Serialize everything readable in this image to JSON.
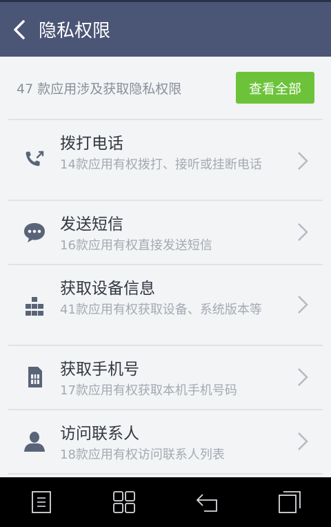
{
  "header": {
    "title": "隐私权限",
    "back_icon": "chevron-left-icon"
  },
  "summary": {
    "text": "47 款应用涉及获取隐私权限",
    "view_all_label": "查看全部",
    "view_all_color": "#6cc33a"
  },
  "permissions": [
    {
      "name": "拨打电话",
      "desc": "14款应用有权拨打、接听或挂断电话",
      "icon": "phone-call-icon"
    },
    {
      "name": "发送短信",
      "desc": "16款应用有权直接发送短信",
      "icon": "sms-bubble-icon"
    },
    {
      "name": "获取设备信息",
      "desc": "41款应用有权获取设备、系统版本等",
      "icon": "device-grid-icon"
    },
    {
      "name": "获取手机号",
      "desc": "17款应用有权获取本机手机号码",
      "icon": "sim-card-icon"
    },
    {
      "name": "访问联系人",
      "desc": "18款应用有权访问联系人列表",
      "icon": "contact-person-icon"
    }
  ],
  "colors": {
    "header_bg": "#4b5576",
    "page_bg": "#f2f4f6",
    "icon_color": "#5a6478"
  },
  "navbar": {
    "icons": [
      "menu-icon",
      "home-grid-icon",
      "back-icon",
      "recent-apps-icon"
    ]
  }
}
